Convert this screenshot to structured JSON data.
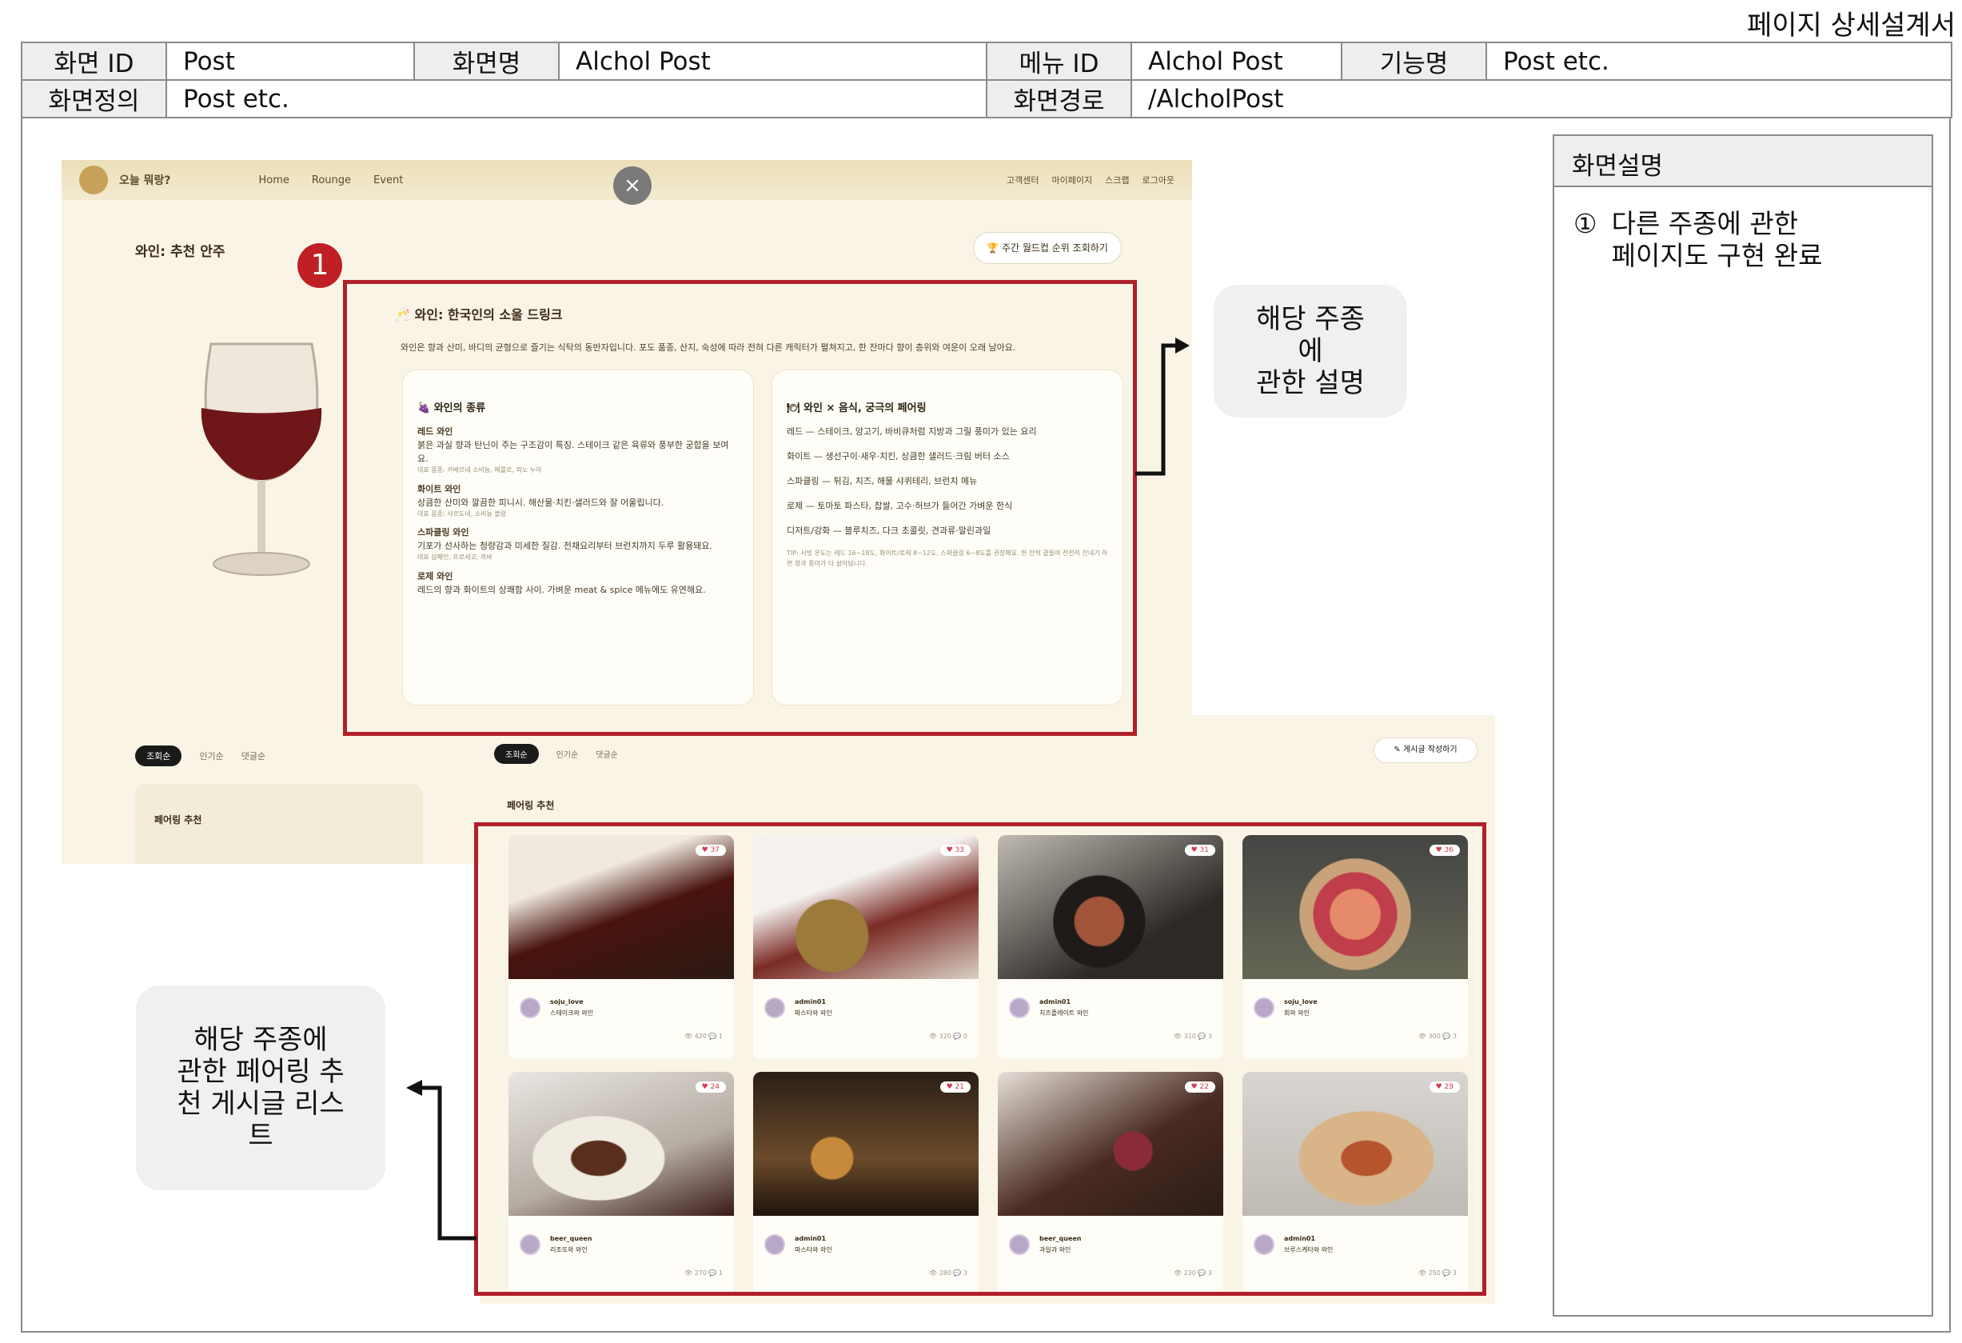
{
  "doc_title": "페이지 상세설계서",
  "header": {
    "screen_id_label": "화면 ID",
    "screen_id": "Post",
    "screen_name_label": "화면명",
    "screen_name": "Alchol Post",
    "menu_id_label": "메뉴 ID",
    "menu_id": "Alchol Post",
    "func_label": "기능명",
    "func_name": "Post etc.",
    "definition_label": "화면정의",
    "definition": "Post etc.",
    "path_label": "화면경로",
    "path": "/AlcholPost"
  },
  "description": {
    "heading": "화면설명",
    "items": [
      {
        "num": "①",
        "text_line1": "다른 주종에 관한",
        "text_line2": "페이지도 구현 완료"
      }
    ]
  },
  "callouts": {
    "right_line1": "해당 주종",
    "right_line2": "에",
    "right_line3": "관한 설명",
    "left_line1": "해당 주종에",
    "left_line2": "관한 페어링 추",
    "left_line3": "천 게시글 리스",
    "left_line4": "트"
  },
  "badge": "1",
  "screenshot": {
    "brand": "오늘 뭐랑?",
    "nav_links": [
      "Home",
      "Rounge",
      "Event"
    ],
    "nav_right": [
      "고객센터",
      "마이페이지",
      "스크랩",
      "로그아웃"
    ],
    "close": "×",
    "page_heading": "와인: 추천 안주",
    "rank_button": "주간 월드컵 순위 조회하기",
    "card_title": "와인: 한국인의 소울 드링크",
    "card_desc": "와인은 향과 산미, 바디의 균형으로 즐기는 식탁의 동반자입니다. 포도 품종, 산지, 숙성에 따라 전혀 다른 캐릭터가 펼쳐지고, 한 잔마다 향이 층위와 여운이 오래 남아요.",
    "types": {
      "heading": "와인의 종류",
      "items": [
        {
          "name": "레드 와인",
          "desc": "붉은 과실 향과 탄닌이 주는 구조감이 특징. 스테이크 같은 육류와 풍부한 궁합을 보여요.",
          "note": "대표 품종: 카베르네 소비뇽, 메를로, 피노 누아"
        },
        {
          "name": "화이트 와인",
          "desc": "상큼한 산미와 깔끔한 피니시. 해산물·치킨·샐러드와 잘 어울립니다.",
          "note": "대표 품종: 샤르도네, 소비뇽 블랑"
        },
        {
          "name": "스파클링 와인",
          "desc": "기포가 선사하는 청량감과 미세한 질감. 전채요리부터 브런치까지 두루 활용돼요.",
          "note": "대표 샴페인, 프로세코, 까바"
        },
        {
          "name": "로제 와인",
          "desc": "레드의 향과 화이트의 상쾌함 사이. 가벼운 meat & spice 메뉴에도 유연해요."
        }
      ]
    },
    "pairing": {
      "heading": "와인 × 음식, 궁극의 페어링",
      "items": [
        "레드 — 스테이크, 양고기, 바비큐처럼 지방과 그릴 풍미가 있는 요리",
        "화이트 — 생선구이·새우·치킨, 상큼한 샐러드·크림 버터 소스",
        "스파클링 — 튀김, 치즈, 해물 샤퀴테리, 브런치 메뉴",
        "로제 — 토마토 파스타, 찹쌀, 고수·허브가 들어간 가벼운 한식",
        "디저트/강화 — 블루치즈, 다크 초콜릿, 견과류·말린과일"
      ],
      "tip": "TIP: 서빙 온도는 레드 16~18도, 화이트/로제 8~12도, 스파클링 6~8도를 권장해요. 한 잔씩 곁들여 천천히 잔내기 하면 향과 풍미가 더 살아납니다."
    },
    "tabs": [
      "조회순",
      "인기순",
      "댓글순"
    ],
    "pair_heading": "페어링 추천",
    "write_button": "게시글 작성하기",
    "posts": [
      {
        "likes": "37",
        "author": "soju_love",
        "title": "스테이크와 와인",
        "views": "420",
        "comments": "1"
      },
      {
        "likes": "33",
        "author": "admin01",
        "title": "파스타와 와인",
        "views": "320",
        "comments": "0"
      },
      {
        "likes": "31",
        "author": "admin01",
        "title": "치즈플레이트 와인",
        "views": "310",
        "comments": "3"
      },
      {
        "likes": "36",
        "author": "soju_love",
        "title": "회와 와인",
        "views": "300",
        "comments": "3"
      },
      {
        "likes": "24",
        "author": "beer_queen",
        "title": "리조또와 와인",
        "views": "270",
        "comments": "1"
      },
      {
        "likes": "21",
        "author": "admin01",
        "title": "파스타와 와인",
        "views": "280",
        "comments": "3"
      },
      {
        "likes": "22",
        "author": "beer_queen",
        "title": "과일과 와인",
        "views": "230",
        "comments": "3"
      },
      {
        "likes": "29",
        "author": "admin01",
        "title": "브루스케타와 와인",
        "views": "250",
        "comments": "3"
      }
    ]
  },
  "colors": {
    "highlight": "#b0202a",
    "badge": "#bf1f25",
    "callout_bg": "#f0f0f0",
    "label_bg": "#eeeeee"
  }
}
